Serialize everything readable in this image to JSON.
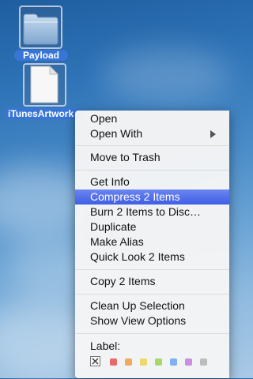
{
  "desktop": {
    "icons": [
      {
        "label": "Payload",
        "icon": "folder-icon"
      },
      {
        "label": "iTunesArtwork",
        "icon": "document-icon"
      }
    ]
  },
  "context_menu": {
    "items": [
      {
        "label": "Open"
      },
      {
        "label": "Open With",
        "submenu": true
      },
      {
        "label": "Move to Trash"
      },
      {
        "label": "Get Info"
      },
      {
        "label": "Compress 2 Items",
        "highlighted": true
      },
      {
        "label": "Burn 2 Items to Disc…"
      },
      {
        "label": "Duplicate"
      },
      {
        "label": "Make Alias"
      },
      {
        "label": "Quick Look 2 Items"
      },
      {
        "label": "Copy 2 Items"
      },
      {
        "label": "Clean Up Selection"
      },
      {
        "label": "Show View Options"
      }
    ],
    "label_section": {
      "title": "Label:",
      "colors": [
        "none",
        "#e86a6a",
        "#f2a860",
        "#eed86a",
        "#a8d86a",
        "#7fb0ef",
        "#c98fe0",
        "#bdbdbd"
      ]
    }
  }
}
